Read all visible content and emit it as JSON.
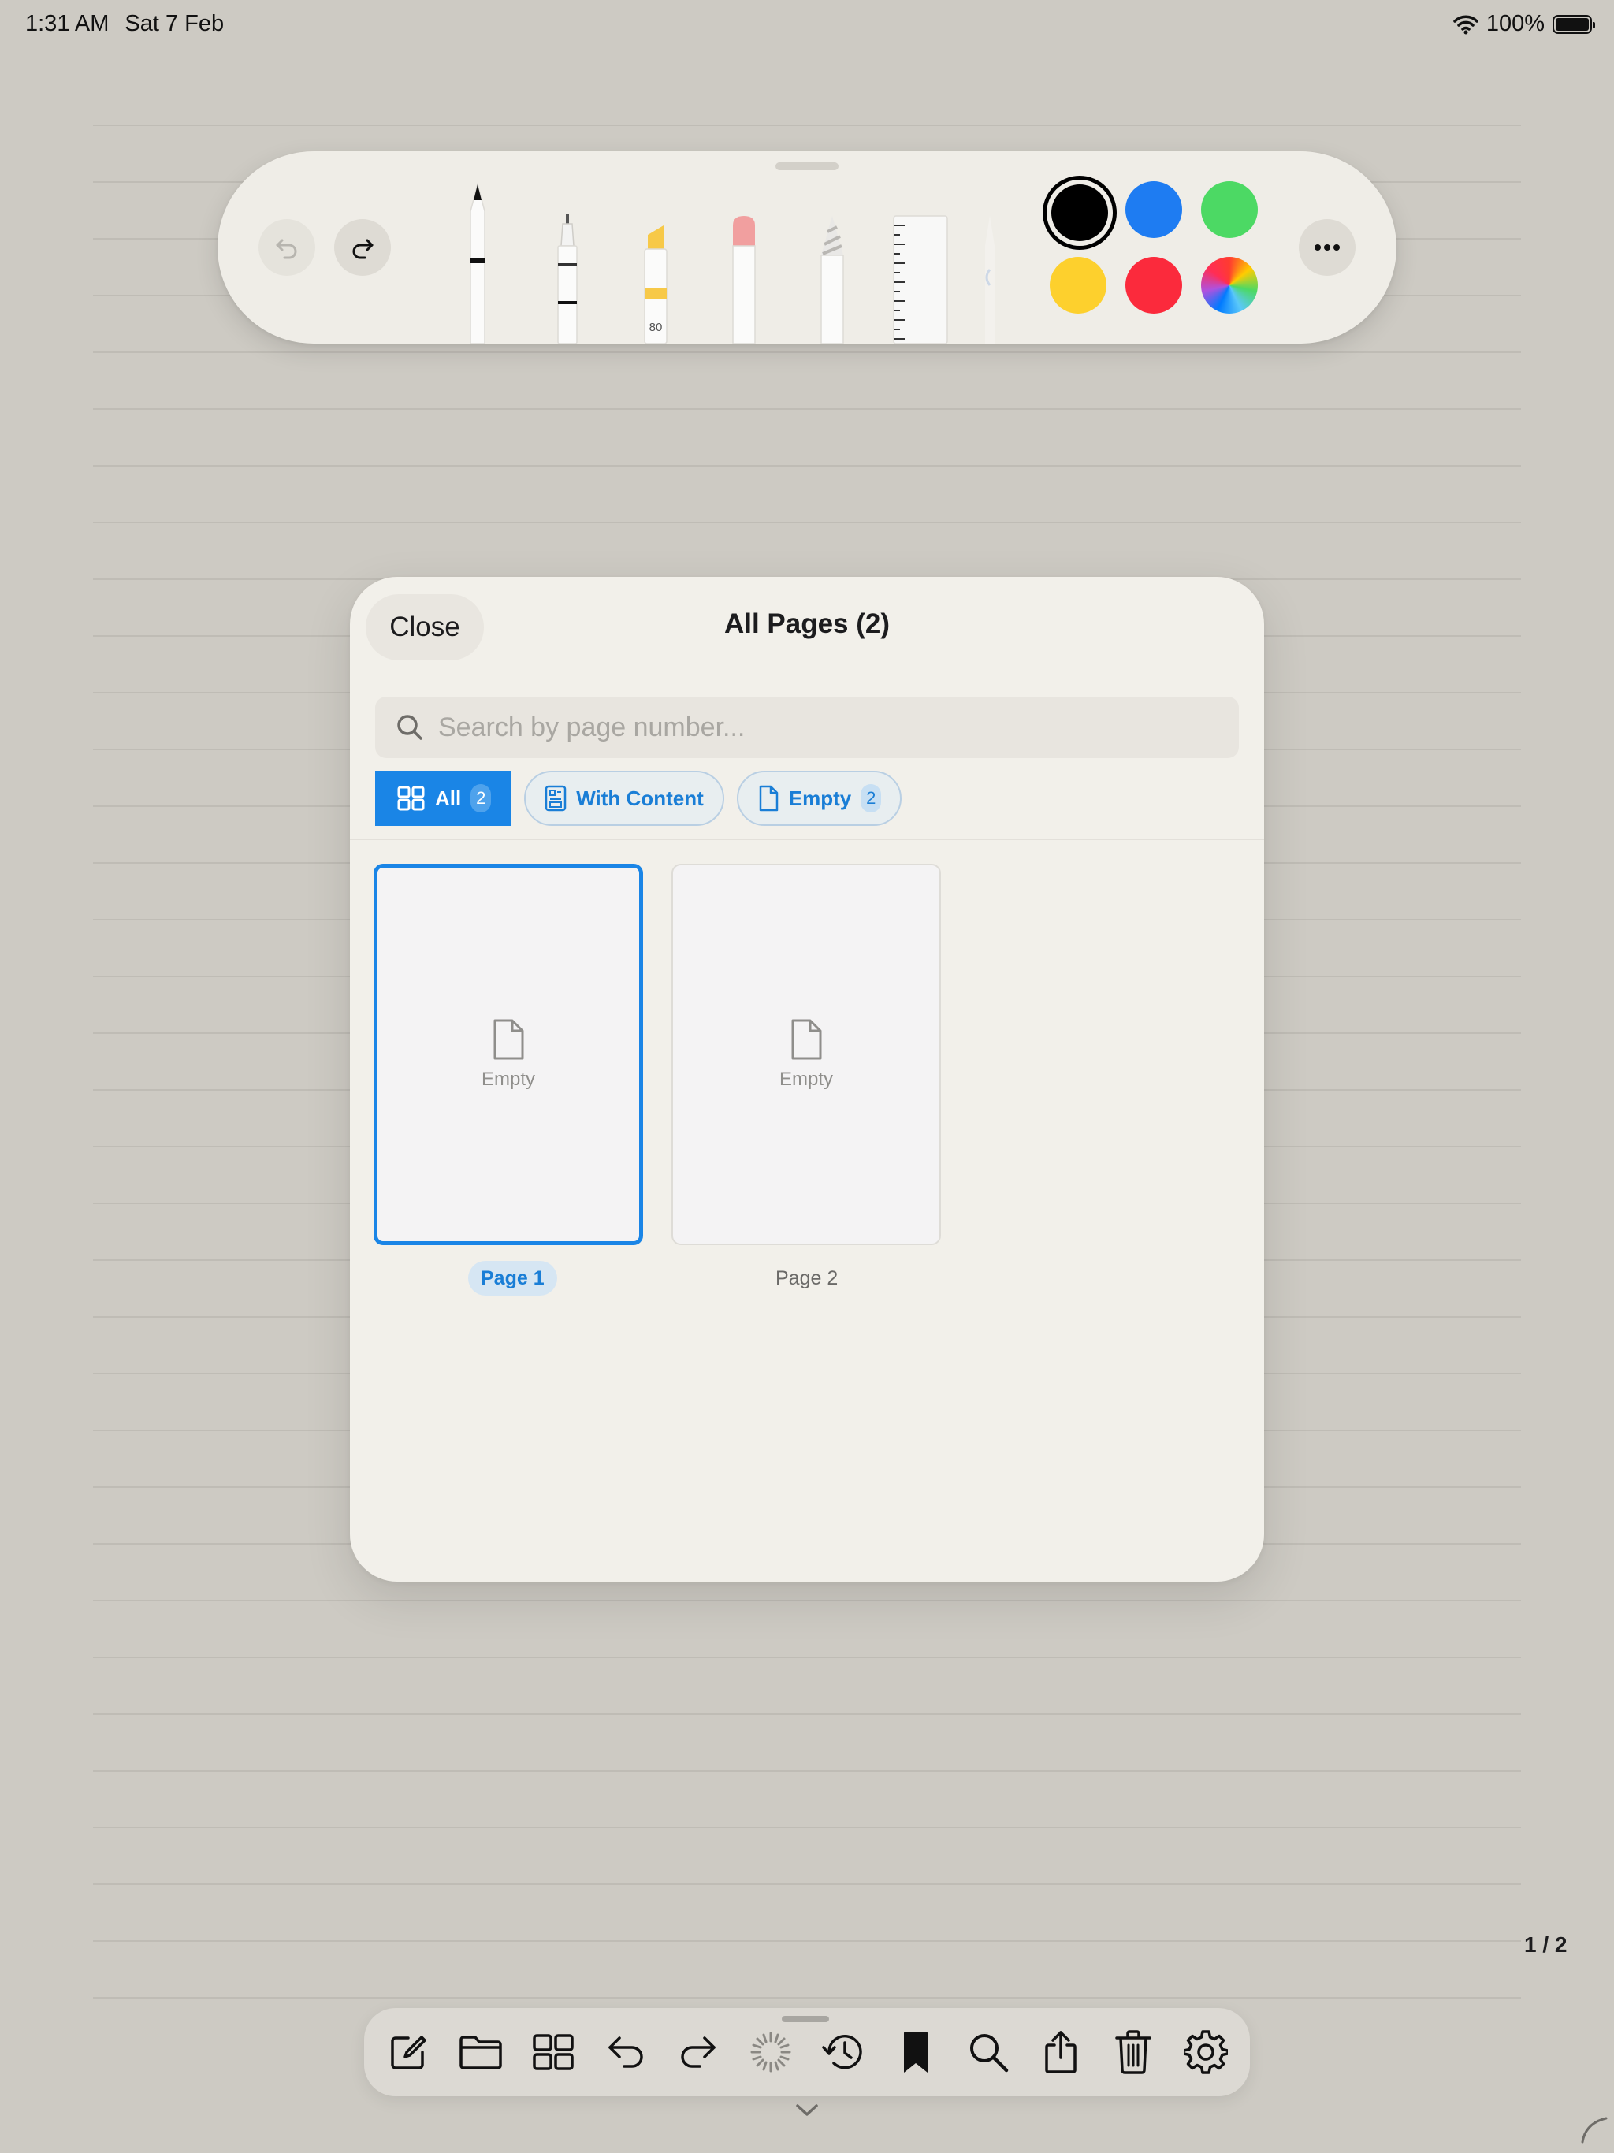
{
  "status_bar": {
    "time": "1:31 AM",
    "date": "Sat 7 Feb",
    "battery": "100%"
  },
  "pencil_toolbar": {
    "highlighter_size": "80",
    "colors": [
      "#000000",
      "#1e7cf2",
      "#4cd964",
      "#fdd02d",
      "#fb2a3c",
      "rainbow"
    ],
    "selected_color": "#000000",
    "icons": [
      "undo-icon",
      "redo-icon",
      "more-icon"
    ]
  },
  "panel": {
    "close_label": "Close",
    "title": "All Pages (2)",
    "search_placeholder": "Search by page number...",
    "filters": [
      {
        "label": "All",
        "count": "2"
      },
      {
        "label": "With Content",
        "count": ""
      },
      {
        "label": "Empty",
        "count": "2"
      }
    ],
    "pages": [
      {
        "label": "Page 1",
        "state": "Empty",
        "selected": true
      },
      {
        "label": "Page 2",
        "state": "Empty",
        "selected": false
      }
    ]
  },
  "page_counter": "1 / 2",
  "bottom_toolbar": {
    "icons": [
      "compose-icon",
      "folder-icon",
      "grid-icon",
      "undo-icon",
      "redo-icon",
      "loading-icon",
      "history-icon",
      "bookmark-icon",
      "search-icon",
      "share-icon",
      "trash-icon",
      "settings-icon"
    ]
  }
}
